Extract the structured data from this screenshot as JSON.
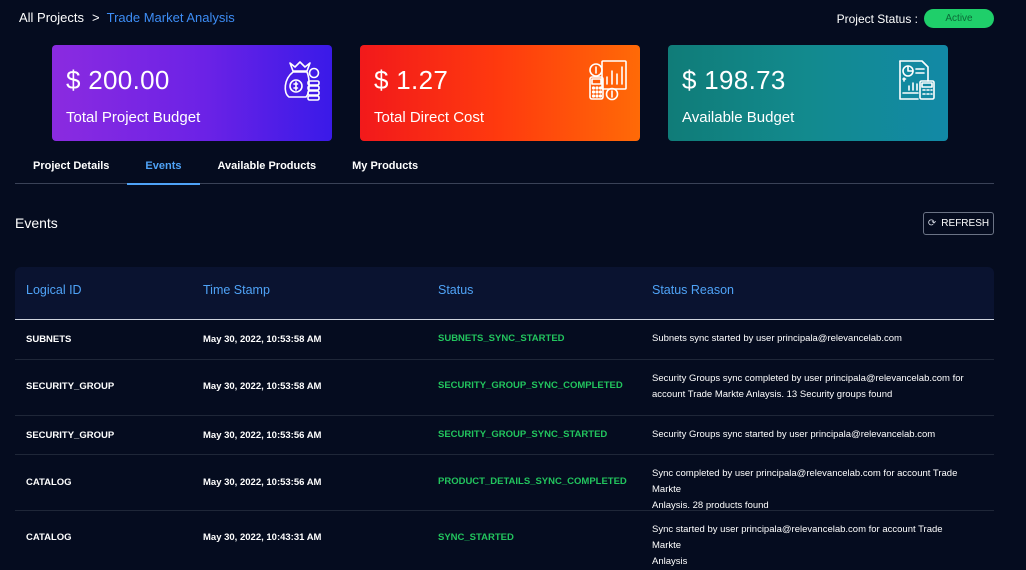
{
  "breadcrumb": {
    "root": "All Projects",
    "separator": ">",
    "current": "Trade Market Analysis"
  },
  "project_status": {
    "label": "Project Status :",
    "value": "Active"
  },
  "cards": [
    {
      "amount": "$ 200.00",
      "caption": "Total Project Budget",
      "icon": "money-bag-icon"
    },
    {
      "amount": "$ 1.27",
      "caption": "Total Direct Cost",
      "icon": "cost-calculator-icon"
    },
    {
      "amount": "$ 198.73",
      "caption": "Available Budget",
      "icon": "budget-report-icon"
    }
  ],
  "tabs": [
    {
      "label": "Project Details",
      "active": false
    },
    {
      "label": "Events",
      "active": true
    },
    {
      "label": "Available Products",
      "active": false
    },
    {
      "label": "My Products",
      "active": false
    }
  ],
  "events": {
    "title": "Events",
    "refresh_label": "REFRESH",
    "columns": [
      "Logical ID",
      "Time Stamp",
      "Status",
      "Status Reason"
    ],
    "rows": [
      {
        "logical_id": "SUBNETS",
        "timestamp": "May 30, 2022, 10:53:58 AM",
        "status": "SUBNETS_SYNC_STARTED",
        "reason_lines": [
          "Subnets sync started by user principala@relevancelab.com"
        ]
      },
      {
        "logical_id": "SECURITY_GROUP",
        "timestamp": "May 30, 2022, 10:53:58 AM",
        "status": "SECURITY_GROUP_SYNC_COMPLETED",
        "reason_lines": [
          "Security Groups sync completed by user principala@relevancelab.com for",
          "account Trade Markte Anlaysis. 13 Security groups found"
        ]
      },
      {
        "logical_id": "SECURITY_GROUP",
        "timestamp": "May 30, 2022, 10:53:56 AM",
        "status": "SECURITY_GROUP_SYNC_STARTED",
        "reason_lines": [
          "Security Groups sync started by user principala@relevancelab.com"
        ]
      },
      {
        "logical_id": "CATALOG",
        "timestamp": "May 30, 2022, 10:53:56 AM",
        "status": "PRODUCT_DETAILS_SYNC_COMPLETED",
        "reason_lines": [
          "Sync completed by user principala@relevancelab.com for account Trade Markte",
          "Anlaysis. 28 products found"
        ]
      },
      {
        "logical_id": "CATALOG",
        "timestamp": "May 30, 2022, 10:43:31 AM",
        "status": "SYNC_STARTED",
        "reason_lines": [
          "Sync started by user principala@relevancelab.com for account Trade Markte",
          "Anlaysis"
        ]
      }
    ]
  },
  "colors": {
    "background": "#050c1f",
    "accent": "#4fa3f7",
    "breadcrumb_link": "#3d8df5",
    "status_green": "#22c55e",
    "active_pill": "#1fcf6a"
  }
}
